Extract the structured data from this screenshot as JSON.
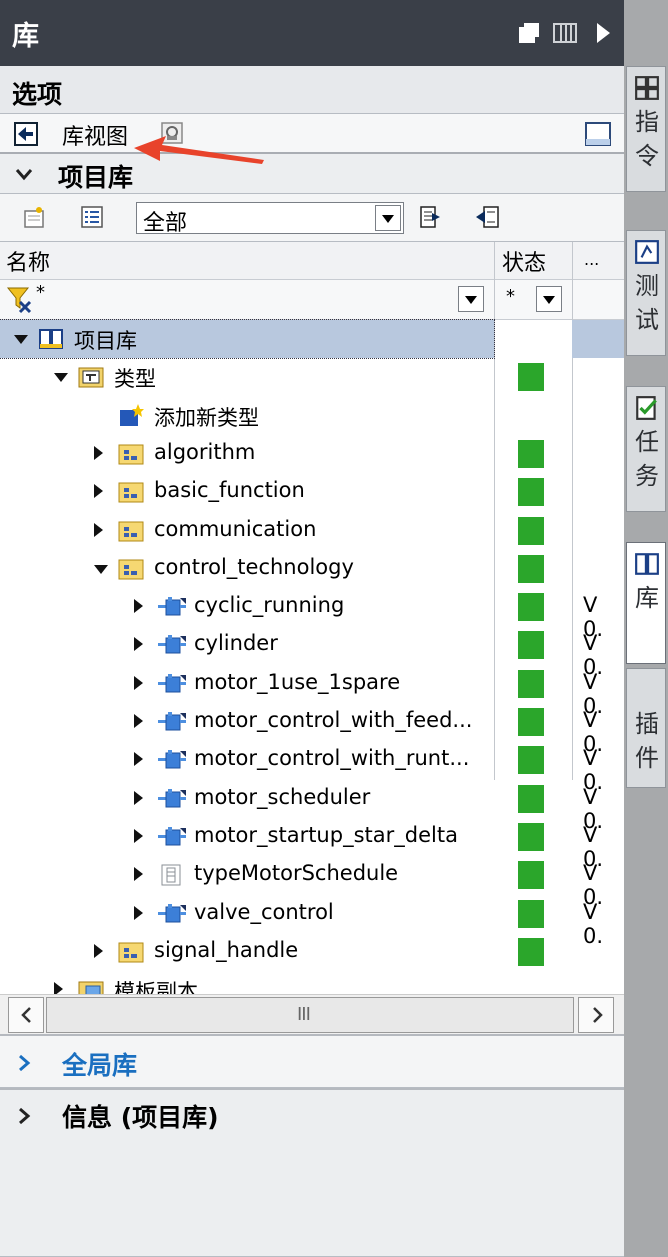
{
  "title": "库",
  "options_label": "选项",
  "library_view_label": "库视图",
  "project_library_section": "项目库",
  "filter": {
    "selected": "全部",
    "name_filter": "*",
    "status_filter": "*"
  },
  "columns": {
    "name": "名称",
    "status": "状态",
    "more": "..."
  },
  "tree": [
    {
      "label": "项目库",
      "level": 0,
      "expander": "down",
      "icon": "library-icon",
      "status": false,
      "version": ""
    },
    {
      "label": "类型",
      "level": 1,
      "expander": "down",
      "icon": "types-folder-icon",
      "status": true,
      "version": ""
    },
    {
      "label": "添加新类型",
      "level": 2,
      "expander": "none",
      "icon": "add-type-icon",
      "status": false,
      "version": ""
    },
    {
      "label": "algorithm",
      "level": 2,
      "expander": "right",
      "icon": "group-folder-icon",
      "status": true,
      "version": ""
    },
    {
      "label": "basic_function",
      "level": 2,
      "expander": "right",
      "icon": "group-folder-icon",
      "status": true,
      "version": ""
    },
    {
      "label": "communication",
      "level": 2,
      "expander": "right",
      "icon": "group-folder-icon",
      "status": true,
      "version": ""
    },
    {
      "label": "control_technology",
      "level": 2,
      "expander": "down",
      "icon": "group-folder-icon",
      "status": true,
      "version": ""
    },
    {
      "label": "cyclic_running",
      "level": 3,
      "expander": "right",
      "icon": "block-type-icon",
      "status": true,
      "version": "V 0."
    },
    {
      "label": "cylinder",
      "level": 3,
      "expander": "right",
      "icon": "block-type-icon",
      "status": true,
      "version": "V 0."
    },
    {
      "label": "motor_1use_1spare",
      "level": 3,
      "expander": "right",
      "icon": "block-type-icon",
      "status": true,
      "version": "V 0."
    },
    {
      "label": "motor_control_with_feed...",
      "level": 3,
      "expander": "right",
      "icon": "block-type-icon",
      "status": true,
      "version": "V 0."
    },
    {
      "label": "motor_control_with_runt...",
      "level": 3,
      "expander": "right",
      "icon": "block-type-icon",
      "status": true,
      "version": "V 0."
    },
    {
      "label": "motor_scheduler",
      "level": 3,
      "expander": "right",
      "icon": "block-type-icon",
      "status": true,
      "version": "V 0."
    },
    {
      "label": "motor_startup_star_delta",
      "level": 3,
      "expander": "right",
      "icon": "block-type-icon",
      "status": true,
      "version": "V 0."
    },
    {
      "label": "typeMotorSchedule",
      "level": 3,
      "expander": "right",
      "icon": "udt-type-icon",
      "status": true,
      "version": "V 0."
    },
    {
      "label": "valve_control",
      "level": 3,
      "expander": "right",
      "icon": "block-type-icon",
      "status": true,
      "version": "V 0."
    },
    {
      "label": "signal_handle",
      "level": 2,
      "expander": "right",
      "icon": "group-folder-icon",
      "status": true,
      "version": ""
    },
    {
      "label": "模板副本",
      "level": 1,
      "expander": "right",
      "icon": "master-copies-folder-icon",
      "status": false,
      "version": ""
    }
  ],
  "scroll_thumb_glyph": "III",
  "global_library_label": "全局库",
  "info_label": "信息 (项目库)",
  "right_tabs": [
    {
      "label": "指令",
      "icon": "instructions-icon"
    },
    {
      "label": "测试",
      "icon": "testing-icon"
    },
    {
      "label": "任务",
      "icon": "tasks-icon"
    },
    {
      "label": "库",
      "icon": "libraries-icon",
      "active": true
    },
    {
      "label": "插件",
      "icon": "addins-icon"
    }
  ],
  "colors": {
    "status_green": "#2ba62b",
    "section_blue": "#1a6fc0",
    "titlebar": "#3a3f48"
  }
}
